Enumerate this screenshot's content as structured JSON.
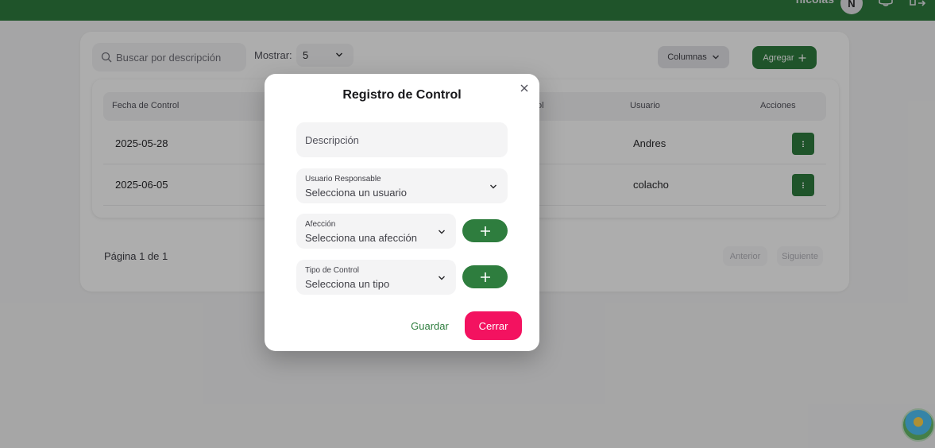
{
  "topbar": {
    "user_name": "nicolas",
    "avatar_initial": "N",
    "bg_color": "#2e7d3e"
  },
  "toolbar": {
    "search_placeholder": "Buscar por descripción",
    "show_label": "Mostrar:",
    "show_value": "5",
    "columns_label": "Columnas",
    "add_label": "Agregar"
  },
  "table": {
    "headers": {
      "date": "Fecha de Control",
      "control_type_partial": "ol",
      "user": "Usuario",
      "actions": "Acciones"
    },
    "rows": [
      {
        "date": "2025-05-28",
        "user": "Andres"
      },
      {
        "date": "2025-06-05",
        "user": "colacho"
      }
    ]
  },
  "pagination": {
    "info": "Página 1 de 1",
    "prev": "Anterior",
    "next": "Siguiente"
  },
  "modal": {
    "title": "Registro de Control",
    "description_placeholder": "Descripción",
    "user_label": "Usuario Responsable",
    "user_value": "Selecciona un usuario",
    "affection_label": "Afección",
    "affection_value": "Selecciona una afección",
    "type_label": "Tipo de Control",
    "type_value": "Selecciona un tipo",
    "save_label": "Guardar",
    "close_label": "Cerrar"
  },
  "colors": {
    "primary": "#2e7d3e",
    "danger": "#f31260"
  },
  "icons": {
    "search": "search-icon",
    "chevron": "chevron-down-icon",
    "plus": "plus-icon",
    "close": "close-icon",
    "more": "more-vertical-icon",
    "bell": "bell-icon",
    "logout": "logout-icon"
  }
}
